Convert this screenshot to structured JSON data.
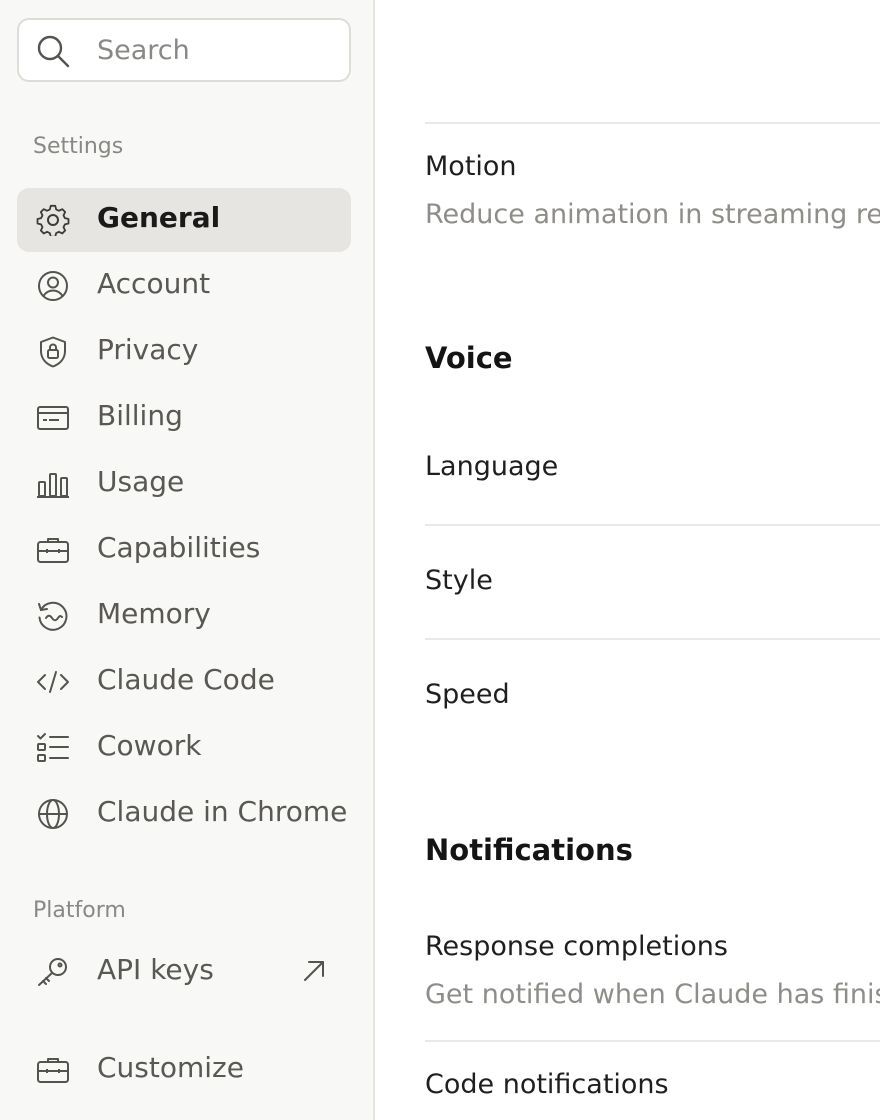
{
  "search": {
    "placeholder": "Search"
  },
  "sidebar": {
    "settings_label": "Settings",
    "platform_label": "Platform",
    "items": [
      {
        "label": "General",
        "icon": "gear-icon",
        "active": true
      },
      {
        "label": "Account",
        "icon": "user-circle-icon"
      },
      {
        "label": "Privacy",
        "icon": "shield-lock-icon"
      },
      {
        "label": "Billing",
        "icon": "credit-card-icon"
      },
      {
        "label": "Usage",
        "icon": "bar-chart-icon"
      },
      {
        "label": "Capabilities",
        "icon": "briefcase-icon"
      },
      {
        "label": "Memory",
        "icon": "memory-icon"
      },
      {
        "label": "Claude Code",
        "icon": "code-icon"
      },
      {
        "label": "Cowork",
        "icon": "checklist-icon"
      },
      {
        "label": "Claude in Chrome",
        "icon": "globe-icon"
      }
    ],
    "platform_items": [
      {
        "label": "API keys",
        "icon": "key-icon",
        "trailing_icon": "external-link-arrow-icon"
      }
    ],
    "bottom_items": [
      {
        "label": "Customize",
        "icon": "briefcase-icon"
      }
    ]
  },
  "main": {
    "motion": {
      "title": "Motion",
      "description": "Reduce animation in streaming resp"
    },
    "voice": {
      "heading": "Voice",
      "language": "Language",
      "style": "Style",
      "speed": "Speed"
    },
    "notifications": {
      "heading": "Notifications",
      "response_completions_title": "Response completions",
      "response_completions_description": "Get notified when Claude has finish",
      "code_notifications_title": "Code notifications"
    }
  },
  "colors": {
    "sidebar_bg": "#f8f8f6",
    "active_item_bg": "#e6e5e1",
    "text_primary": "#1f1f1f",
    "text_secondary": "#8f8d88"
  }
}
